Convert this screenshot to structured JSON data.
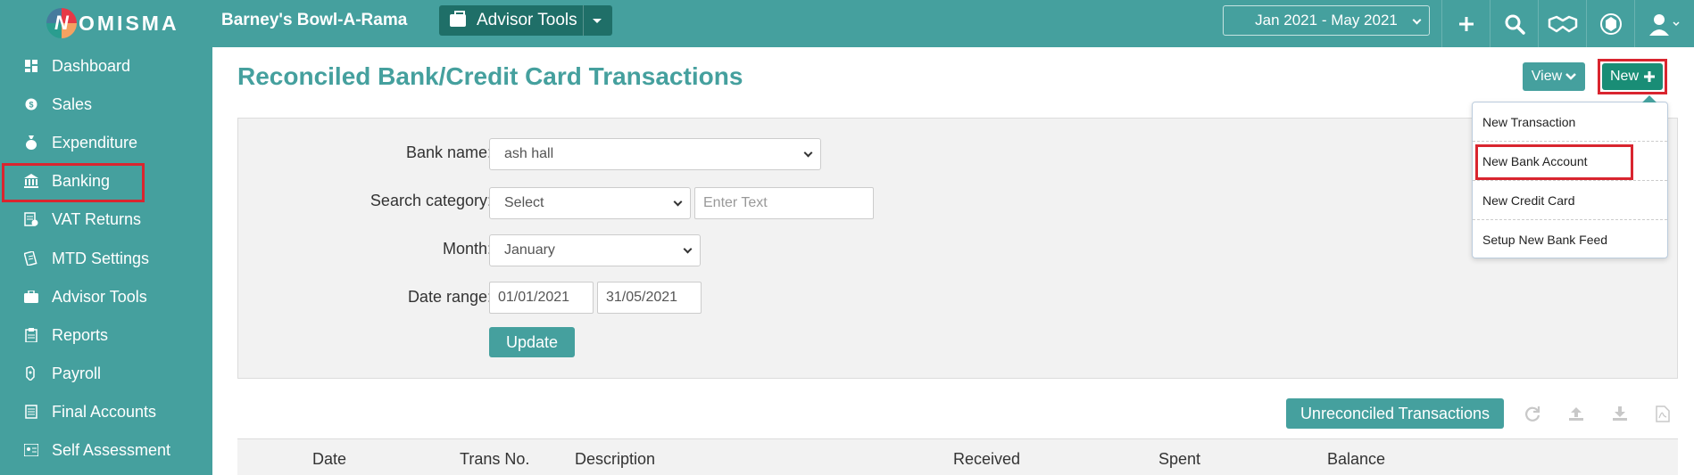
{
  "header": {
    "logo_text": "OMISMA",
    "logo_letter": "N",
    "company": "Barney's Bowl-A-Rama",
    "advisor_tools": "Advisor Tools",
    "period": "Jan 2021 - May 2021",
    "icons": [
      "plus-icon",
      "search-icon",
      "handshake-icon",
      "crest-icon",
      "user-icon"
    ]
  },
  "sidebar": {
    "items": [
      {
        "label": "Dashboard",
        "icon": "dashboard-icon"
      },
      {
        "label": "Sales",
        "icon": "sales-icon"
      },
      {
        "label": "Expenditure",
        "icon": "money-bag-icon"
      },
      {
        "label": "Banking",
        "icon": "bank-icon"
      },
      {
        "label": "VAT Returns",
        "icon": "vat-icon"
      },
      {
        "label": "MTD Settings",
        "icon": "mtd-icon"
      },
      {
        "label": "Advisor Tools",
        "icon": "briefcase-icon"
      },
      {
        "label": "Reports",
        "icon": "reports-icon"
      },
      {
        "label": "Payroll",
        "icon": "payroll-icon"
      },
      {
        "label": "Final Accounts",
        "icon": "final-accounts-icon"
      },
      {
        "label": "Self Assessment",
        "icon": "self-assessment-icon"
      }
    ],
    "active": "Banking"
  },
  "main": {
    "title": "Reconciled Bank/Credit Card Transactions",
    "view_label": "View",
    "new_label": "New"
  },
  "dropdown": {
    "items": [
      "New Transaction",
      "New Bank Account",
      "New Credit Card",
      "Setup New Bank Feed"
    ],
    "highlighted": "New Bank Account"
  },
  "filters": {
    "bank_name_label": "Bank name:",
    "bank_name_value": "ash hall",
    "category_label": "Search category:",
    "category_value": "Select",
    "category_text_placeholder": "Enter Text",
    "month_label": "Month:",
    "month_value": "January",
    "date_range_label": "Date range:",
    "date_from": "01/01/2021",
    "date_to": "31/05/2021",
    "update_label": "Update"
  },
  "actions": {
    "unreconciled_label": "Unreconciled Transactions",
    "icons": [
      "refresh-icon",
      "upload-icon",
      "download-icon",
      "pdf-icon"
    ]
  },
  "table": {
    "columns": [
      "Date",
      "Trans No.",
      "Description",
      "Received",
      "Spent",
      "Balance"
    ]
  },
  "colors": {
    "teal": "#45a09e",
    "dark_teal": "#1f6f68",
    "green": "#198d76",
    "highlight_red": "#d9252f"
  }
}
